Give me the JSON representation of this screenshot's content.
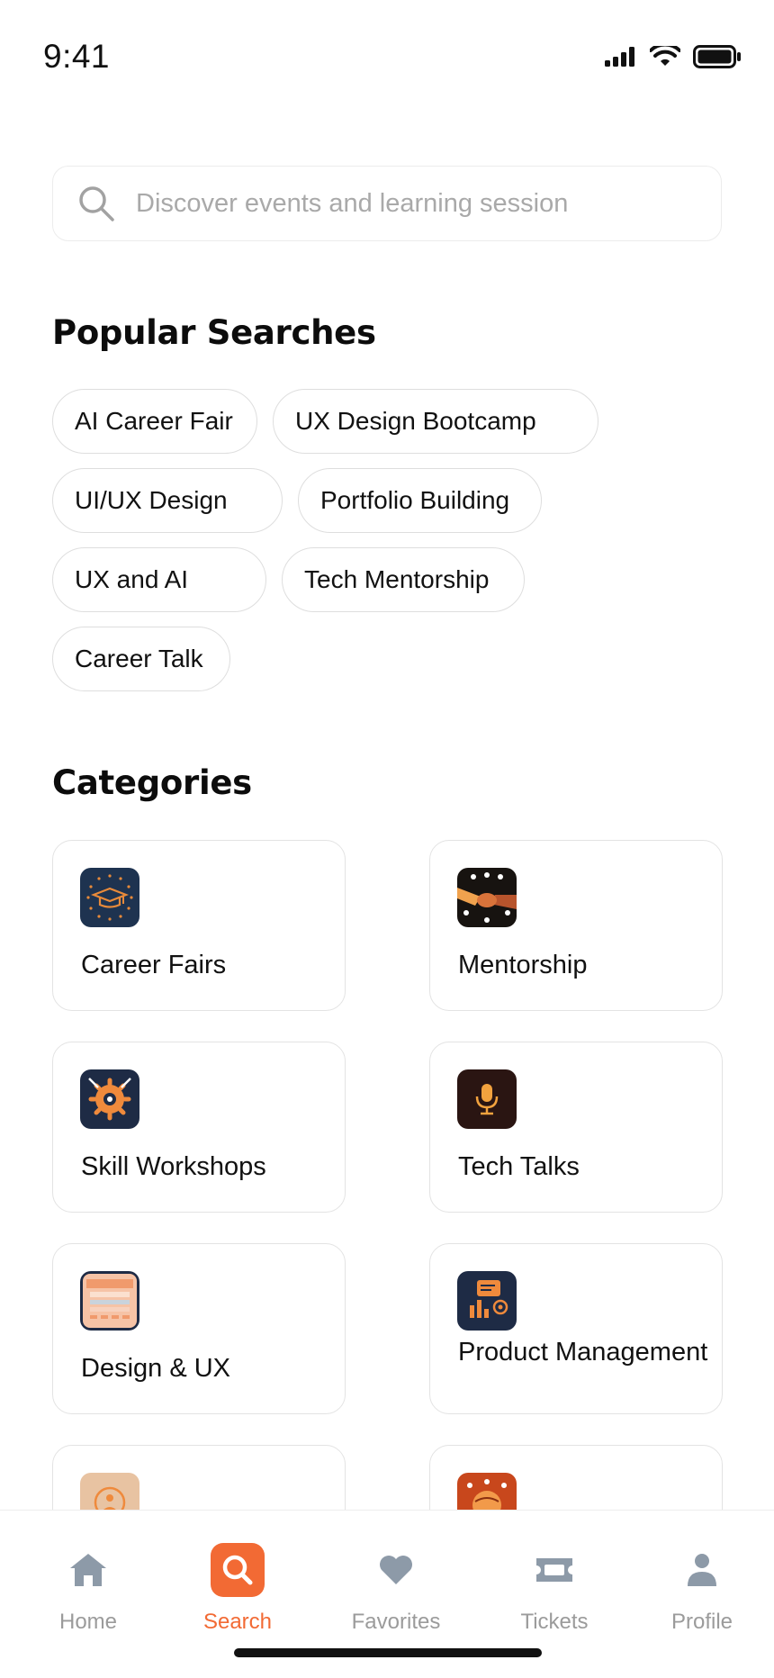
{
  "status_bar": {
    "time": "9:41"
  },
  "search": {
    "placeholder": "Discover events and learning session"
  },
  "popular": {
    "title": "Popular Searches",
    "chips": [
      "AI Career Fair",
      "UX Design Bootcamp",
      "UI/UX Design",
      "Portfolio Building",
      "UX and AI",
      "Tech Mentorship",
      "Career Talk"
    ]
  },
  "categories": {
    "title": "Categories",
    "items": [
      {
        "label": "Career Fairs",
        "icon": "graduation-cap-icon"
      },
      {
        "label": "Mentorship",
        "icon": "handshake-icon"
      },
      {
        "label": "Skill Workshops",
        "icon": "gear-tools-icon"
      },
      {
        "label": "Tech Talks",
        "icon": "microphone-icon"
      },
      {
        "label": "Design & UX",
        "icon": "wireframe-icon"
      },
      {
        "label": "Product Management",
        "icon": "presentation-icon"
      },
      {
        "label": "",
        "icon": "person-icon"
      },
      {
        "label": "",
        "icon": "globe-icon"
      }
    ]
  },
  "nav": {
    "items": [
      {
        "label": "Home",
        "icon": "home-icon"
      },
      {
        "label": "Search",
        "icon": "search-icon"
      },
      {
        "label": "Favorites",
        "icon": "heart-icon"
      },
      {
        "label": "Tickets",
        "icon": "ticket-icon"
      },
      {
        "label": "Profile",
        "icon": "profile-icon"
      }
    ],
    "active": "Search"
  },
  "colors": {
    "accent": "#f26a34",
    "inactive": "#9b9b9b",
    "navy": "#1e2b45"
  }
}
